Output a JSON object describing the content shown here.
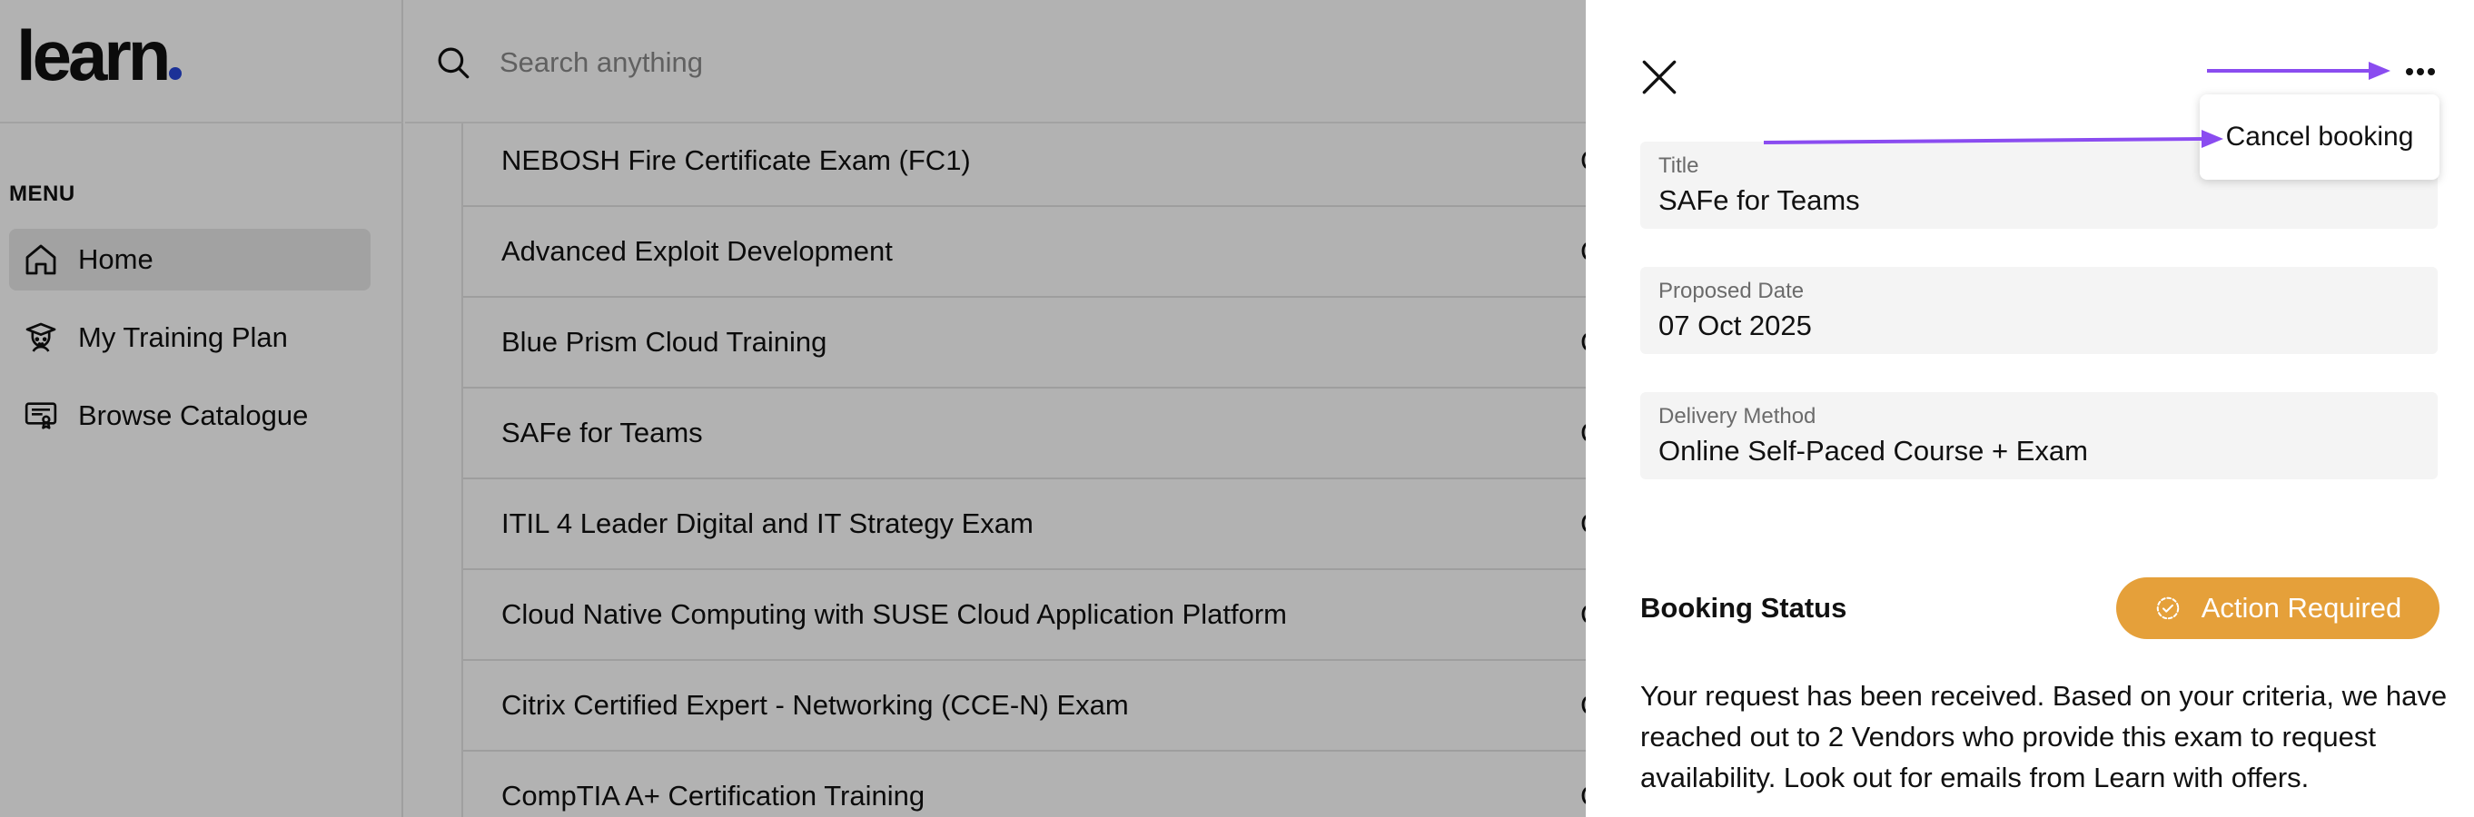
{
  "brand": {
    "logo_text": "learn",
    "dot_color": "#2747d8"
  },
  "sidebar": {
    "menu_heading": "MENU",
    "items": [
      {
        "label": "Home",
        "icon": "home-icon",
        "active": true
      },
      {
        "label": "My Training Plan",
        "icon": "graduate-icon",
        "active": false
      },
      {
        "label": "Browse Catalogue",
        "icon": "certificate-icon",
        "active": false
      }
    ]
  },
  "search": {
    "placeholder": "Search anything"
  },
  "courses": [
    {
      "name": "NEBOSH Fire Certificate Exam (FC1)",
      "code": "C"
    },
    {
      "name": "Advanced Exploit Development",
      "code": "C"
    },
    {
      "name": "Blue Prism Cloud Training",
      "code": "C"
    },
    {
      "name": "SAFe for Teams",
      "code": "C"
    },
    {
      "name": "ITIL 4 Leader Digital and IT Strategy Exam",
      "code": "C"
    },
    {
      "name": "Cloud Native Computing with SUSE Cloud Application Platform",
      "code": "C"
    },
    {
      "name": "Citrix Certified Expert - Networking (CCE-N) Exam",
      "code": "C"
    },
    {
      "name": "CompTIA A+ Certification Training",
      "code": "C"
    }
  ],
  "drawer": {
    "menu": {
      "cancel_label": "Cancel booking"
    },
    "fields": [
      {
        "label": "Title",
        "value": "SAFe for Teams"
      },
      {
        "label": "Proposed Date",
        "value": "07 Oct 2025"
      },
      {
        "label": "Delivery Method",
        "value": "Online Self-Paced Course + Exam"
      }
    ],
    "status": {
      "label": "Booking Status",
      "badge": "Action Required",
      "badge_color": "#e5a03a",
      "message": "Your request has been received. Based on your criteria, we have reached out to 2 Vendors who provide this exam to request availability. Look out for emails from Learn with offers."
    }
  },
  "colors": {
    "annotation_arrow": "#8a4cf0",
    "overlay": "rgba(0,0,0,0.30)"
  }
}
